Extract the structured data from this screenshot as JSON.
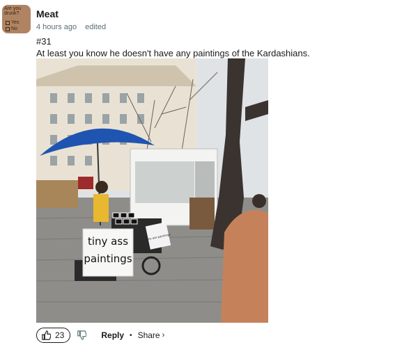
{
  "comment": {
    "avatar": {
      "question": "Are you drunk?",
      "options": [
        "Yes",
        "No"
      ]
    },
    "username": "Meat",
    "time": "4 hours ago",
    "edited": "edited",
    "number": "#31",
    "text": "At least you know he doesn't have any paintings of the Kardashians.",
    "image": {
      "sign_main": [
        "tiny ass",
        "paintings"
      ],
      "sign_side": "tiny ass paintings"
    },
    "actions": {
      "upvotes": "23",
      "reply": "Reply",
      "bullet": "•",
      "share": "Share"
    }
  }
}
